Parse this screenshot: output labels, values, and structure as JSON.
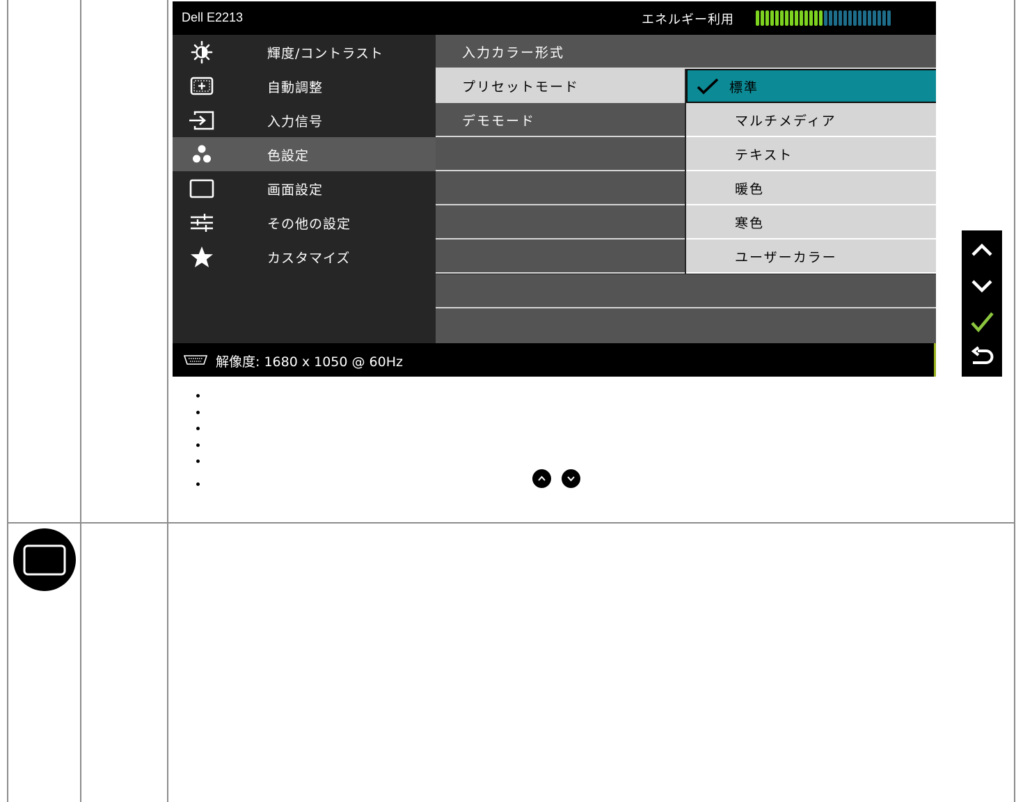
{
  "osd": {
    "model": "Dell E2213",
    "energy_label": "エネルギー利用",
    "energy_level": 0.5,
    "menu": [
      {
        "icon": "brightness-icon",
        "label": "輝度/コントラスト"
      },
      {
        "icon": "auto-adjust-icon",
        "label": "自動調整"
      },
      {
        "icon": "input-source-icon",
        "label": "入力信号"
      },
      {
        "icon": "color-settings-icon",
        "label": "色設定",
        "selected": true
      },
      {
        "icon": "display-settings-icon",
        "label": "画面設定"
      },
      {
        "icon": "other-settings-icon",
        "label": "その他の設定"
      },
      {
        "icon": "star-icon",
        "label": "カスタマイズ"
      }
    ],
    "submenu": [
      "入力カラー形式",
      "プリセットモード",
      "デモモード"
    ],
    "submenu_selected": "プリセットモード",
    "options": [
      "標準",
      "マルチメディア",
      "テキスト",
      "暖色",
      "寒色",
      "ユーザーカラー"
    ],
    "option_active": "標準",
    "footer": "解像度: 1680 x 1050 @ 60Hz"
  },
  "nav": [
    "up-arrow-icon",
    "down-arrow-icon",
    "check-icon",
    "back-icon"
  ],
  "colors": {
    "osd_bg": "#262626",
    "selected_row": "#5a5a5a",
    "highlight": "#d6d6d6",
    "active_option": "#0c8a95",
    "energy_on": "#7ed321",
    "energy_off": "#1e6d8a",
    "check_green": "#8cc63f"
  }
}
